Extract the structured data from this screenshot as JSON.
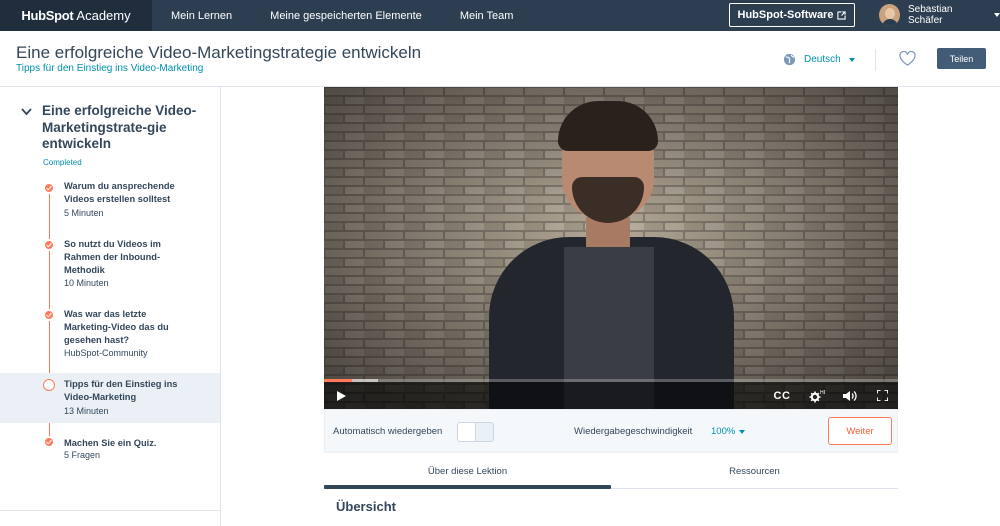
{
  "nav": {
    "brand_bold": "HubSpot",
    "brand_rest": "Academy",
    "links": [
      "Mein Lernen",
      "Meine gespeicherten Elemente",
      "Mein Team"
    ],
    "software_button": "HubSpot-Software",
    "user_name": "Sebastian Schäfer"
  },
  "header": {
    "title": "Eine erfolgreiche Video-Marketingstrategie entwickeln",
    "subtitle": "Tipps für den Einstieg ins Video-Marketing",
    "language": "Deutsch",
    "share_label": "Teilen"
  },
  "sidebar": {
    "course_title": "Eine erfolgreiche Video-Marketingstrate-gie entwickeln",
    "status": "Completed",
    "lessons": [
      {
        "title": "Warum du ansprechende Videos erstellen solltest",
        "meta": "5 Minuten"
      },
      {
        "title": "So nutzt du Videos im Rahmen der Inbound-Methodik",
        "meta": "10 Minuten"
      },
      {
        "title": "Was war das letzte Marketing-Video das du gesehen hast?",
        "meta": "HubSpot-Community"
      },
      {
        "title": "Tipps für den Einstieg ins Video-Marketing",
        "meta": "13 Minuten"
      },
      {
        "title": "Machen Sie ein Quiz.",
        "meta": "5 Fragen"
      }
    ]
  },
  "player": {
    "cc_label": "CC",
    "progress_played": 0.049,
    "progress_buffered": 0.094
  },
  "controls": {
    "autoplay_label": "Automatisch wiedergeben",
    "speed_label": "Wiedergabegeschwindigkeit",
    "speed_value": "100%",
    "next_label": "Weiter"
  },
  "tabs": [
    "Über diese Lektion",
    "Ressourcen"
  ],
  "section_title": "Übersicht",
  "colors": {
    "nav_bg": "#2d3e50",
    "accent": "#ff7a59",
    "link": "#0091ae",
    "text": "#33475b"
  }
}
